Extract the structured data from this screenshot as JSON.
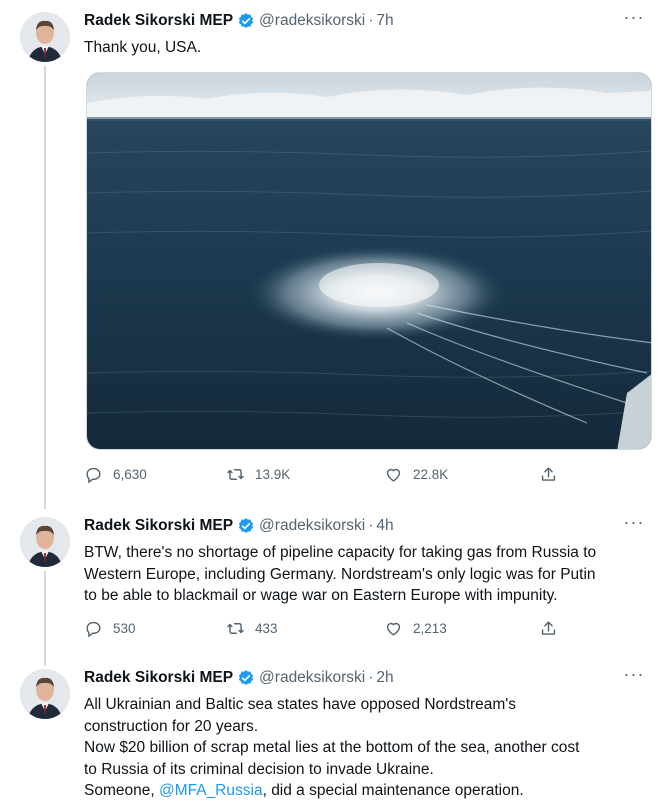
{
  "colors": {
    "accent": "#1d9bf0",
    "muted": "#536471",
    "text": "#0f1419"
  },
  "tweets": [
    {
      "name": "Radek Sikorski MEP",
      "handle": "@radeksikorski",
      "dot": "·",
      "time": "7h",
      "text": "Thank you, USA.",
      "replies": "6,630",
      "retweets": "13.9K",
      "likes": "22.8K"
    },
    {
      "name": "Radek Sikorski MEP",
      "handle": "@radeksikorski",
      "dot": "·",
      "time": "4h",
      "text": "BTW, there's no shortage of pipeline capacity for taking gas from Russia to\nWestern Europe, including Germany. Nordstream's only logic was for Putin\nto be able to blackmail or wage war on Eastern Europe with impunity.",
      "replies": "530",
      "retweets": "433",
      "likes": "2,213"
    },
    {
      "name": "Radek Sikorski MEP",
      "handle": "@radeksikorski",
      "dot": "·",
      "time": "2h",
      "text_before": "All Ukrainian and Baltic sea states have opposed Nordstream's\nconstruction for 20 years.\nNow $20 billion of scrap metal lies at the bottom of the sea, another cost\nto Russia of its criminal decision to invade Ukraine.\nSomeone, ",
      "mention": "@MFA_Russia",
      "text_after": ", did a special maintenance operation."
    }
  ]
}
